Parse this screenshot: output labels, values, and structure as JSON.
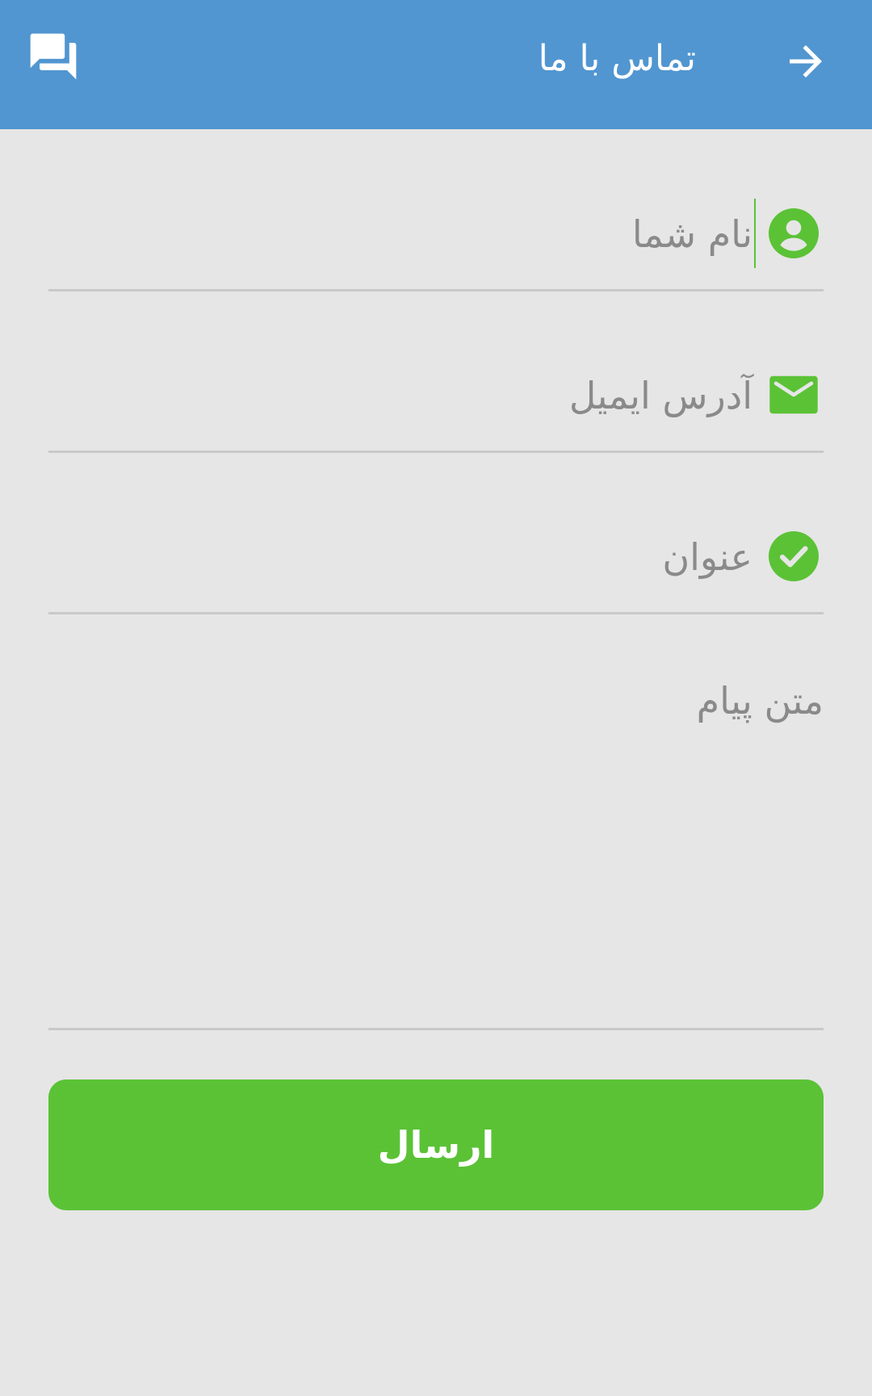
{
  "appbar": {
    "title": "تماس با ما",
    "back_icon": "arrow-right-icon",
    "chat_icon": "chat-bubbles-icon",
    "color": "#5196d0"
  },
  "form": {
    "name": {
      "placeholder": "نام شما",
      "value": "",
      "icon": "person-icon"
    },
    "email": {
      "placeholder": "آدرس ایمیل",
      "value": "",
      "icon": "envelope-icon"
    },
    "subject": {
      "placeholder": "عنوان",
      "value": "",
      "icon": "check-circle-icon"
    },
    "message": {
      "placeholder": "متن پیام",
      "value": ""
    },
    "submit_label": "ارسال",
    "accent_color": "#5bc236"
  }
}
